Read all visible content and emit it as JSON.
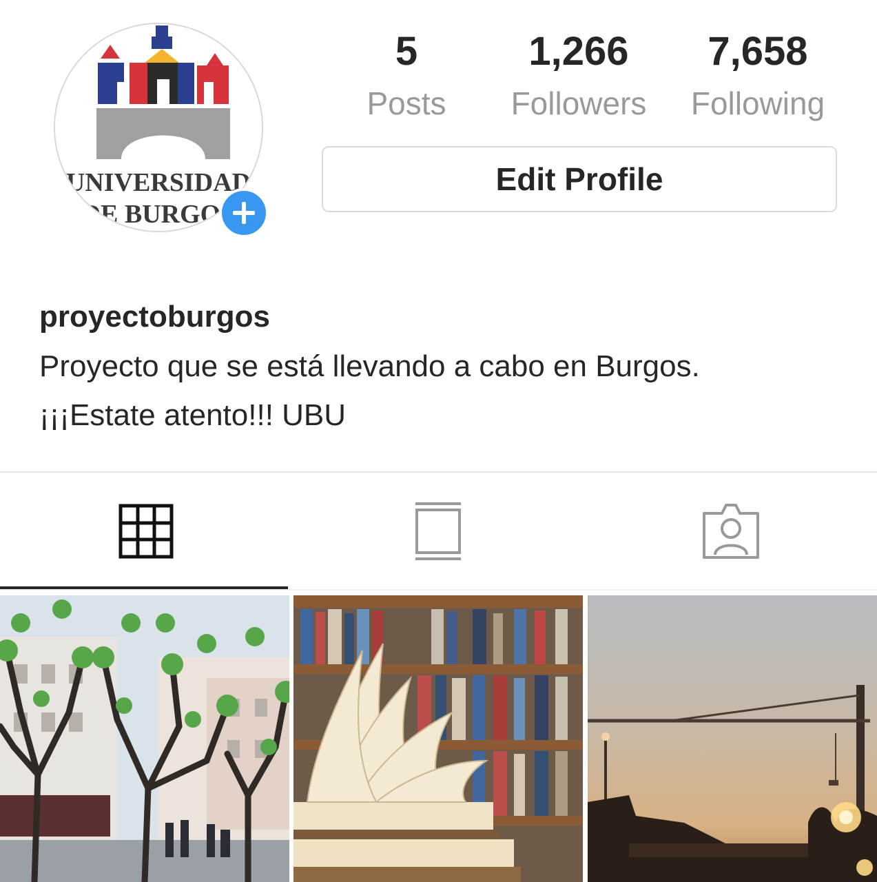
{
  "profile": {
    "avatar_text_line1": "UNIVERSIDAD",
    "avatar_text_line2": "DE BURGOS",
    "username": "proyectoburgos",
    "bio_line1": "Proyecto que se está llevando a cabo en Burgos.",
    "bio_line2": "¡¡¡Estate atento!!! UBU",
    "edit_label": "Edit Profile"
  },
  "stats": [
    {
      "value": "5",
      "label": "Posts"
    },
    {
      "value": "1,266",
      "label": "Followers"
    },
    {
      "value": "7,658",
      "label": "Following"
    }
  ],
  "tabs": [
    {
      "icon": "grid-icon",
      "active": true
    },
    {
      "icon": "feed-list-icon",
      "active": false
    },
    {
      "icon": "tagged-person-icon",
      "active": false
    }
  ],
  "colors": {
    "accent": "#3897f0",
    "text": "#262626",
    "secondary": "#999999",
    "border": "#dbdbdb"
  },
  "posts": [
    {
      "subject": "trees-street"
    },
    {
      "subject": "books-library"
    },
    {
      "subject": "sunset-crane"
    }
  ]
}
